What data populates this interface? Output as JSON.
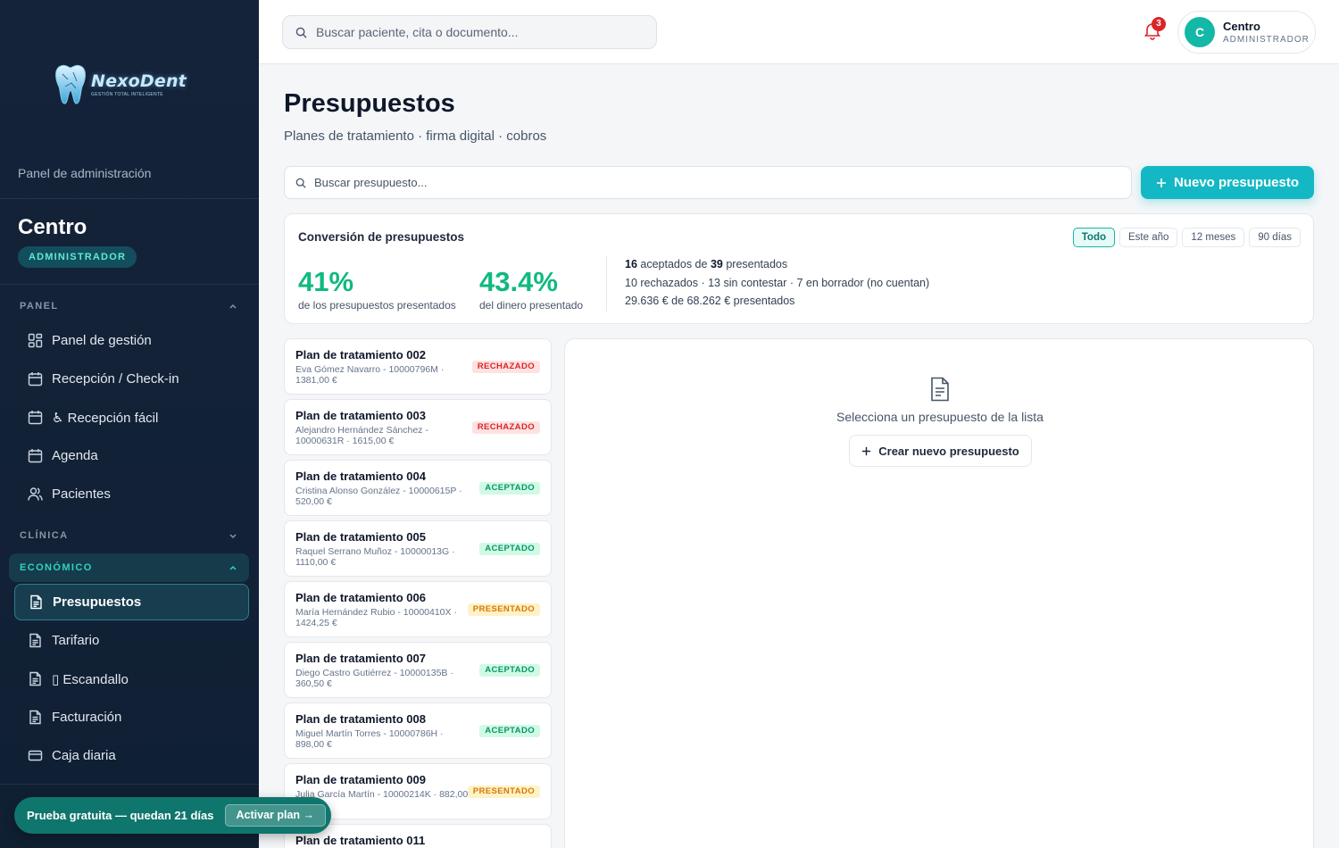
{
  "sidebar": {
    "logo": {
      "name": "NexoDent",
      "tagline": "GESTIÓN TOTAL INTELIGENTE"
    },
    "panel_caption": "Panel de administración",
    "centre_name": "Centro",
    "role": "ADMINISTRADOR",
    "sections": [
      {
        "label": "PANEL",
        "expanded": true,
        "active": false
      },
      {
        "label": "CLÍNICA",
        "expanded": false,
        "active": false
      },
      {
        "label": "ECONÓMICO",
        "expanded": true,
        "active": true
      }
    ],
    "items": [
      {
        "label": "Panel de gestión",
        "icon": "dashboard-icon"
      },
      {
        "label": "Recepción / Check-in",
        "icon": "calendar-icon"
      },
      {
        "label": "♿ Recepción fácil",
        "icon": "calendar-icon"
      },
      {
        "label": "Agenda",
        "icon": "calendar-icon"
      },
      {
        "label": "Pacientes",
        "icon": "users-icon"
      },
      {
        "label": "Presupuestos",
        "icon": "document-icon",
        "active": true
      },
      {
        "label": "Tarifario",
        "icon": "document-icon"
      },
      {
        "label": "▯ Escandallo",
        "icon": "document-icon"
      },
      {
        "label": "Facturación",
        "icon": "document-icon"
      },
      {
        "label": "Caja diaria",
        "icon": "card-icon"
      }
    ],
    "trial": {
      "text": "Prueba gratuita — quedan 21 días",
      "button": "Activar plan →"
    }
  },
  "topbar": {
    "search_placeholder": "Buscar paciente, cita o documento...",
    "notification_count": "3",
    "user": {
      "initial": "C",
      "name": "Centro",
      "role": "ADMINISTRADOR"
    }
  },
  "page": {
    "title": "Presupuestos",
    "subtitle": "Planes de tratamiento · firma digital · cobros",
    "search_placeholder": "Buscar presupuesto...",
    "new_button": "Nuevo presupuesto"
  },
  "conversion": {
    "title": "Conversión de presupuestos",
    "filters": [
      "Todo",
      "Este año",
      "12 meses",
      "90 días"
    ],
    "active_filter": "Todo",
    "pct_count": "41%",
    "pct_count_caption": "de los presupuestos presentados",
    "pct_money": "43.4%",
    "pct_money_caption": "del dinero presentado",
    "accepted": "16",
    "accepted_text": "aceptados de",
    "presented": "39",
    "presented_text": "presentados",
    "detail_line": "10 rechazados · 13 sin contestar · 7 en borrador (no cuentan)",
    "money_line": "29.636 € de 68.262 € presentados"
  },
  "budgets": [
    {
      "title": "Plan de tratamiento 002",
      "subtitle": "Eva Gómez Navarro - 10000796M · 1381,00 €",
      "status": "RECHAZADO",
      "status_class": "rechazado"
    },
    {
      "title": "Plan de tratamiento 003",
      "subtitle": "Alejandro Hernández Sánchez - 10000631R · 1615,00 €",
      "status": "RECHAZADO",
      "status_class": "rechazado"
    },
    {
      "title": "Plan de tratamiento 004",
      "subtitle": "Cristina Alonso González - 10000615P · 520,00 €",
      "status": "ACEPTADO",
      "status_class": "aceptado"
    },
    {
      "title": "Plan de tratamiento 005",
      "subtitle": "Raquel Serrano Muñoz - 10000013G · 1110,00 €",
      "status": "ACEPTADO",
      "status_class": "aceptado"
    },
    {
      "title": "Plan de tratamiento 006",
      "subtitle": "María Hernández Rubio - 10000410X · 1424,25 €",
      "status": "PRESENTADO",
      "status_class": "presentado"
    },
    {
      "title": "Plan de tratamiento 007",
      "subtitle": "Diego Castro Gutiérrez - 10000135B · 360,50 €",
      "status": "ACEPTADO",
      "status_class": "aceptado"
    },
    {
      "title": "Plan de tratamiento 008",
      "subtitle": "Miguel Martín Torres - 10000786H · 898,00 €",
      "status": "ACEPTADO",
      "status_class": "aceptado"
    },
    {
      "title": "Plan de tratamiento 009",
      "subtitle": "Julia García Martín - 10000214K · 882,00 €",
      "status": "PRESENTADO",
      "status_class": "presentado"
    },
    {
      "title": "Plan de tratamiento 011",
      "subtitle": "",
      "status": "",
      "status_class": "presentado"
    }
  ],
  "detail": {
    "empty_text": "Selecciona un presupuesto de la lista",
    "create_button": "Crear nuevo presupuesto"
  },
  "colors": {
    "accent": "#14b8c4",
    "success": "#10b981",
    "danger": "#dc2626",
    "warning": "#d97706",
    "sidebar": "#15233a"
  }
}
